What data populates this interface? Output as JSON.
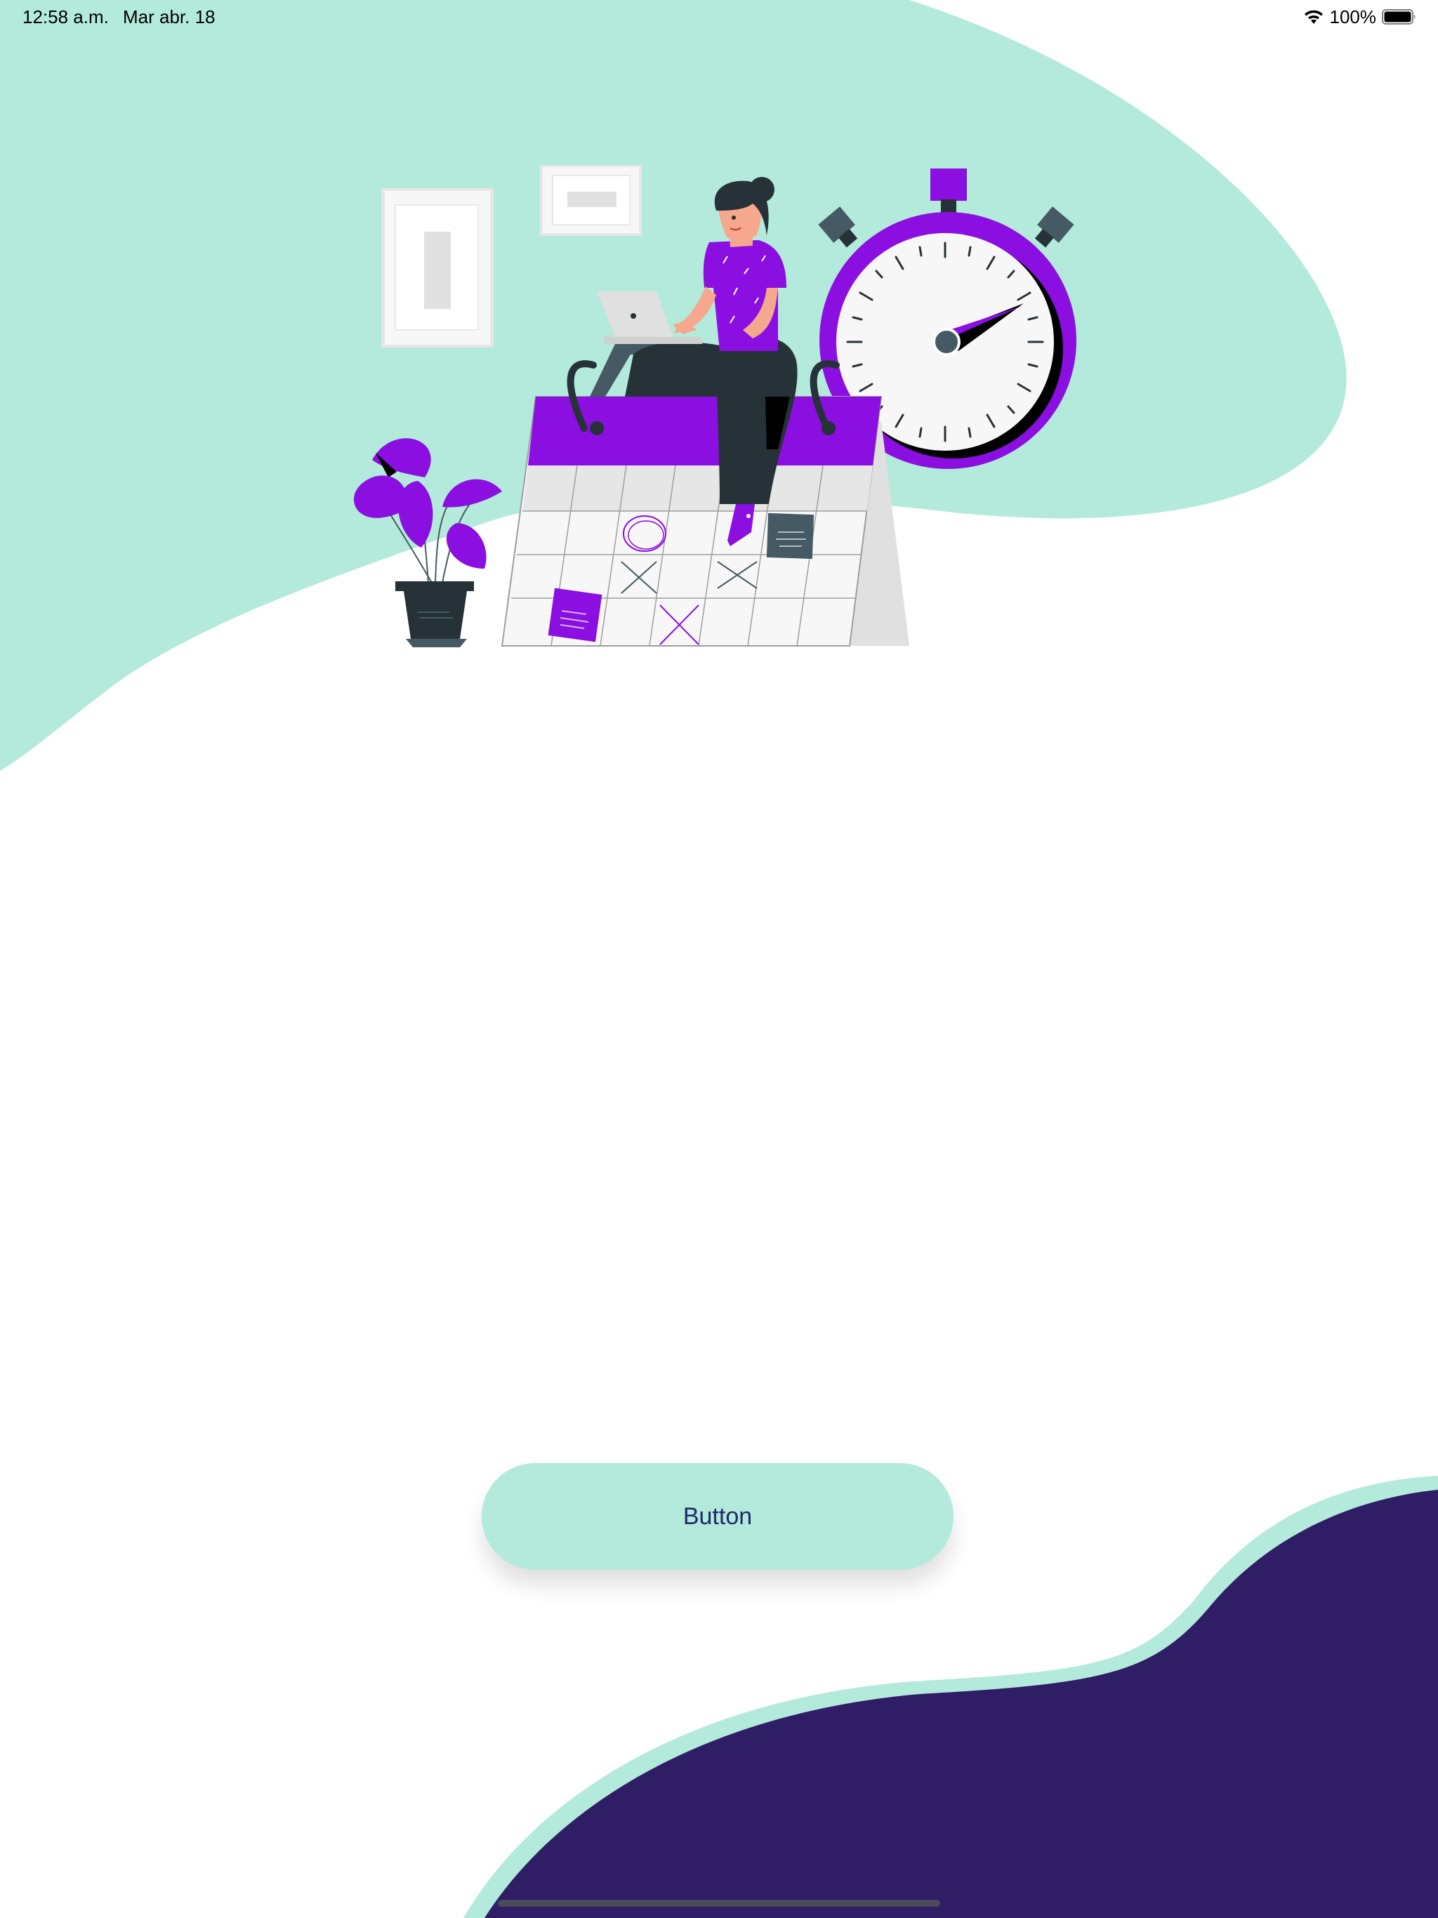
{
  "status_bar": {
    "time": "12:58 a.m.",
    "date": "Mar abr. 18",
    "battery_percent": "100%",
    "wifi_icon": "wifi-icon",
    "battery_icon": "battery-full-icon"
  },
  "illustration": {
    "description_icon": "woman-working-calendar-stopwatch-illustration"
  },
  "primary_button": {
    "label": "Button"
  },
  "colors": {
    "mint": "#B4EADB",
    "deep_purple": "#2F1D66",
    "accent_purple": "#8A0FE0",
    "button_text": "#1F2A6A",
    "dark_gray": "#263238"
  }
}
